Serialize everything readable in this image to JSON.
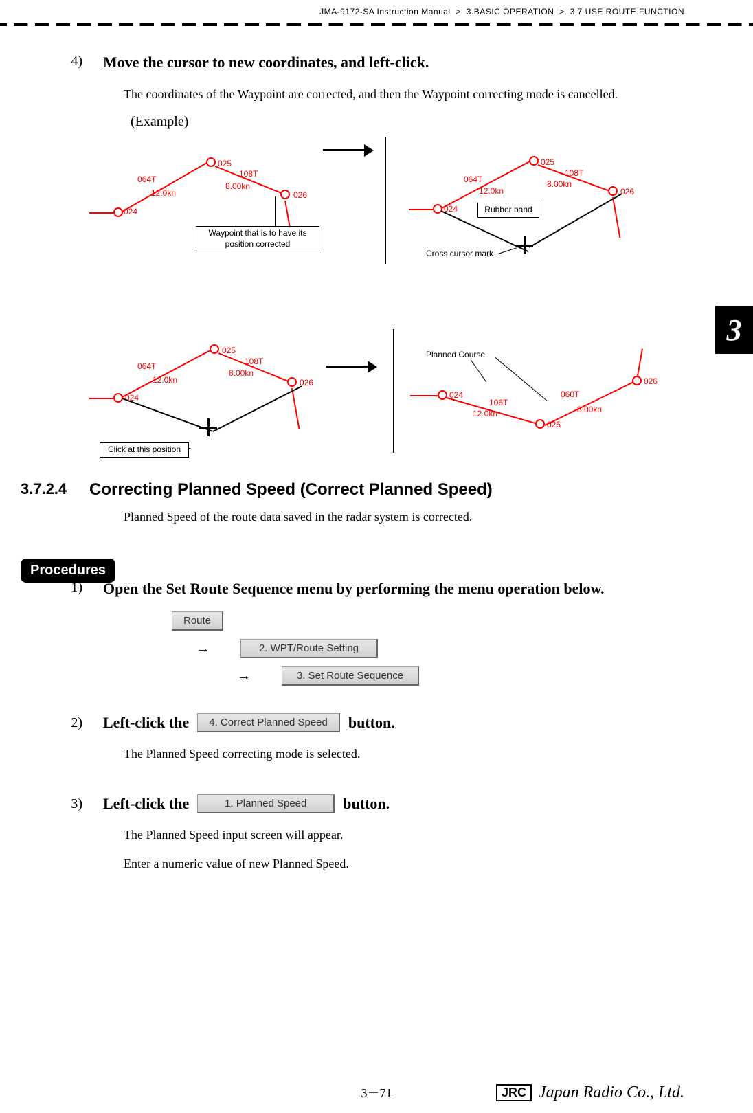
{
  "header": {
    "manual": "JMA-9172-SA Instruction Manual",
    "chapter": "3.BASIC OPERATION",
    "section": "3.7  USE ROUTE FUNCTION",
    "sep": ">"
  },
  "step4": {
    "num": "4)",
    "title": "Move the cursor to new coordinates, and left-click.",
    "body": "The coordinates of the Waypoint are corrected, and then the Waypoint correcting mode is cancelled.",
    "example": "(Example)"
  },
  "diagram1": {
    "labels": {
      "wp024": "024",
      "wp025": "025",
      "wp026": "026",
      "hdg1": "064T",
      "spd1": "12.0kn",
      "hdg2": "108T",
      "spd2": "8.00kn",
      "anno_wp": "Waypoint that is to have its\nposition corrected",
      "rubber": "Rubber band",
      "cross": "Cross cursor mark"
    }
  },
  "diagram2": {
    "labels": {
      "click": "Click at this position",
      "planned": "Planned Course",
      "wp024": "024",
      "wp025": "025",
      "wp026": "026",
      "hdg1": "064T",
      "spd1": "12.0kn",
      "hdg2": "108T",
      "spd2": "8.00kn",
      "hdg3": "106T",
      "hdg4": "060T"
    }
  },
  "section3724": {
    "num": "3.7.2.4",
    "title": "Correcting Planned Speed (Correct Planned Speed)",
    "body": "Planned Speed of the route data saved in the radar system is corrected."
  },
  "procedures_label": "Procedures",
  "proc1": {
    "num": "1)",
    "title": "Open the Set Route Sequence menu by performing the menu operation below."
  },
  "menu": {
    "route": "Route",
    "wpt": "2. WPT/Route Setting",
    "setroute": "3. Set Route Sequence",
    "correctspd": "4. Correct Planned Speed",
    "plannedspd": "1. Planned Speed",
    "arrow": "→"
  },
  "proc2": {
    "num": "2)",
    "pre": "Left-click the",
    "post": "button.",
    "body": "The Planned Speed correcting mode is selected."
  },
  "proc3": {
    "num": "3)",
    "pre": "Left-click the",
    "post": "button.",
    "body1": "The Planned Speed input screen will appear.",
    "body2": "Enter a numeric value of new Planned Speed."
  },
  "footer": {
    "page": "3－71",
    "jrc": "JRC",
    "company": "Japan Radio Co., Ltd."
  },
  "side_tab": "3"
}
